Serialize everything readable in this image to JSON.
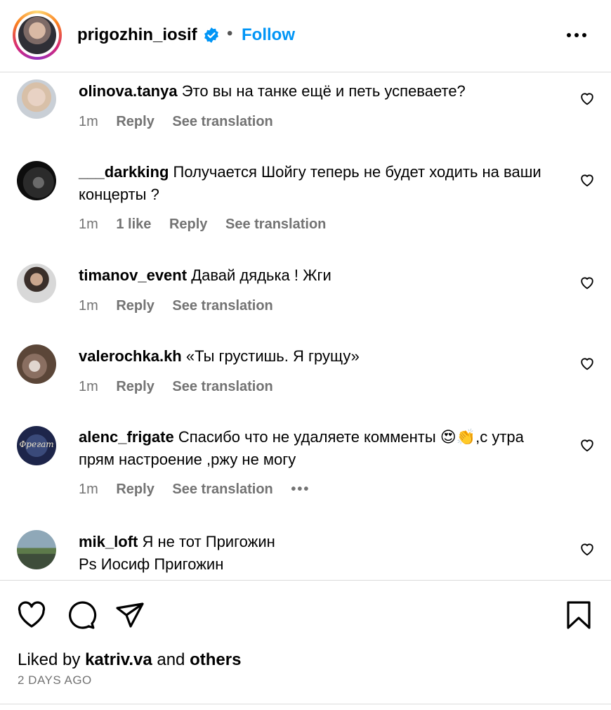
{
  "post_header": {
    "username": "prigozhin_iosif",
    "separator": "•",
    "follow_label": "Follow",
    "accent_color": "#0095f6"
  },
  "comments": [
    {
      "username": "olinova.tanya",
      "text": "Это вы на танке ещё и петь успеваете?",
      "time": "1m",
      "likes": "",
      "reply_label": "Reply",
      "translation_label": "See translation"
    },
    {
      "username": "___darkking",
      "text": "Получается Шойгу теперь не будет ходить на ваши концерты ?",
      "time": "1m",
      "likes": "1 like",
      "reply_label": "Reply",
      "translation_label": "See translation"
    },
    {
      "username": "timanov_event",
      "text": "Давай дядька ! Жги",
      "time": "1m",
      "likes": "",
      "reply_label": "Reply",
      "translation_label": "See translation"
    },
    {
      "username": "valerochka.kh",
      "text": "«Ты грустишь. Я грущу»",
      "time": "1m",
      "likes": "",
      "reply_label": "Reply",
      "translation_label": "See translation"
    },
    {
      "username": "alenc_frigate",
      "text": "Спасибо что не удаляете комменты 😍👏,с утра прям настроение ,ржу не могу",
      "time": "1m",
      "likes": "",
      "reply_label": "Reply",
      "translation_label": "See translation",
      "more": "•••",
      "avatar_text": "Фрегат"
    },
    {
      "username": "mik_loft",
      "text": "Я не тот Пригожин",
      "text_line2": "Ps Иосиф Пригожин",
      "time": "",
      "likes": "",
      "reply_label": "",
      "translation_label": ""
    }
  ],
  "footer": {
    "liked_prefix": "Liked by ",
    "liked_user": "katriv.va",
    "liked_and": " and ",
    "liked_others": "others",
    "time_ago": "2 DAYS AGO"
  },
  "icons": {
    "verified": "verified-badge-icon",
    "more": "more-options-icon",
    "heart": "heart-icon",
    "comment": "comment-icon",
    "share": "share-icon",
    "save": "bookmark-icon"
  }
}
